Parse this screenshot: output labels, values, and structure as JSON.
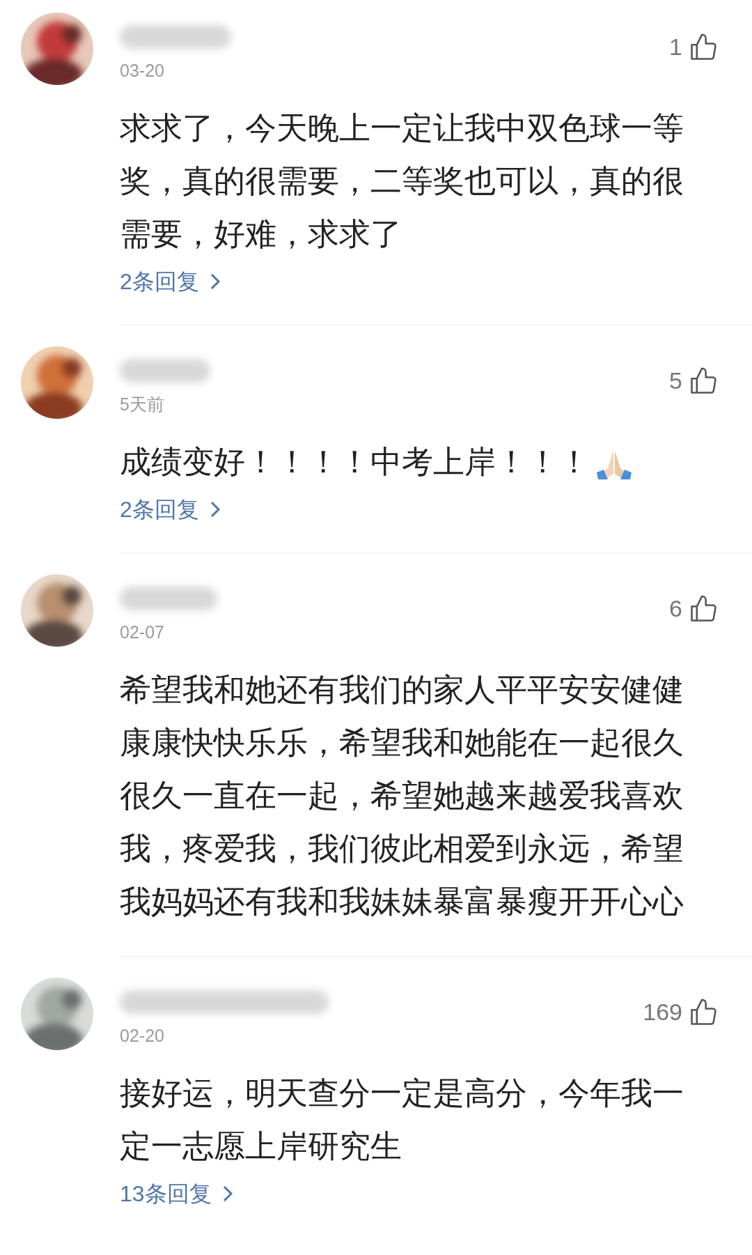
{
  "comments": [
    {
      "date": "03-20",
      "likes": "1",
      "text": "求求了，今天晚上一定让我中双色球一等奖，真的很需要，二等奖也可以，真的很需要，好难，求求了",
      "replies": "2条回复",
      "has_emoji": false
    },
    {
      "date": "5天前",
      "likes": "5",
      "text": "成绩变好！！！！中考上岸！！！",
      "replies": "2条回复",
      "has_emoji": true
    },
    {
      "date": "02-07",
      "likes": "6",
      "text": "希望我和她还有我们的家人平平安安健健康康快快乐乐，希望我和她能在一起很久很久一直在一起，希望她越来越爱我喜欢我，疼爱我，我们彼此相爱到永远，希望我妈妈还有我和我妹妹暴富暴瘦开开心心",
      "has_emoji": false
    },
    {
      "date": "02-20",
      "likes": "169",
      "text": "接好运，明天查分一定是高分，今年我一定一志愿上岸研究生",
      "replies": "13条回复",
      "has_emoji": false
    }
  ]
}
